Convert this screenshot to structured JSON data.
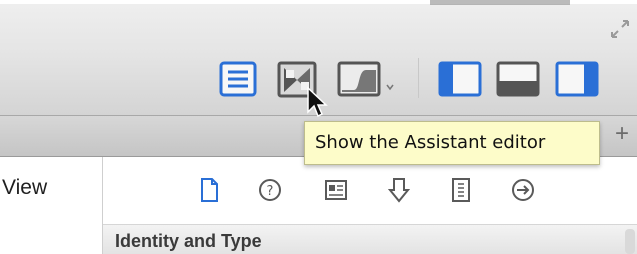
{
  "toolbar": {
    "editor_modes": [
      {
        "name": "standard-editor",
        "icon": "standard-editor-icon",
        "state": "selected"
      },
      {
        "name": "assistant-editor",
        "icon": "assistant-editor-icon",
        "state": "hovered"
      },
      {
        "name": "version-editor",
        "icon": "version-editor-icon",
        "state": "normal"
      }
    ],
    "view_toggles": [
      {
        "name": "navigator",
        "icon": "left-panel-icon",
        "active": true
      },
      {
        "name": "debug-area",
        "icon": "bottom-panel-icon",
        "active": false
      },
      {
        "name": "utilities",
        "icon": "right-panel-icon",
        "active": true
      }
    ],
    "fullscreen_icon": "fullscreen-arrows-icon"
  },
  "tooltip": {
    "text": "Show the Assistant editor"
  },
  "tabbar": {
    "add_tab_label": "+"
  },
  "left_pane": {
    "label": "View"
  },
  "inspector": {
    "icons": [
      "file-inspector-icon",
      "quick-help-icon",
      "identity-inspector-icon",
      "attributes-inspector-icon",
      "size-inspector-icon",
      "connections-inspector-icon"
    ],
    "section_title": "Identity and Type"
  },
  "colors": {
    "accent_blue": "#2a6fd6",
    "tooltip_bg": "#fdfcc9",
    "icon_gray": "#5a5a5a"
  }
}
